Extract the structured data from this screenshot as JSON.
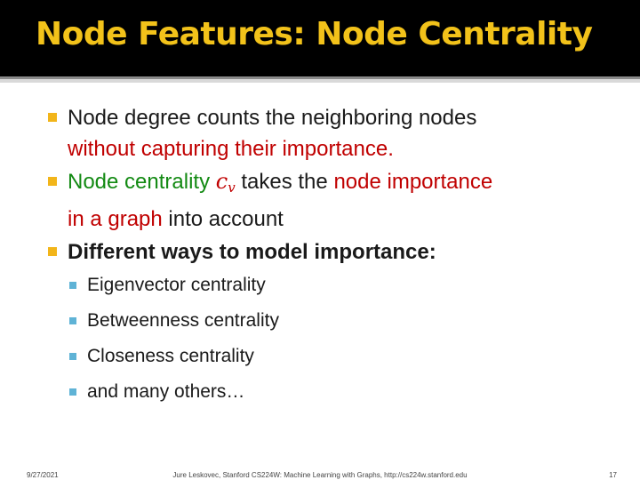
{
  "title": "Node Features: Node Centrality",
  "bullets": {
    "b1": {
      "text1": "Node degree counts the neighboring nodes",
      "text2": "without capturing their importance."
    },
    "b2": {
      "part1": "Node centrality",
      "math_base": "c",
      "math_sub": "v",
      "part2": "takes the",
      "part3": "node importance",
      "part4": "in a graph",
      "part5": "into account"
    },
    "b3": "Different ways to model importance:",
    "sub": [
      "Eigenvector centrality",
      "Betweenness centrality",
      "Closeness centrality",
      "and many others…"
    ]
  },
  "footer": {
    "date": "9/27/2021",
    "center": "Jure Leskovec, Stanford CS224W: Machine Learning with Graphs, http://cs224w.stanford.edu",
    "page": "17"
  },
  "colors": {
    "title": "#f2c21a",
    "title_bar": "#000000",
    "highlight_red": "#c00000",
    "highlight_green": "#138a13",
    "bullet_l1": "#f2b51a",
    "bullet_l2": "#5fb3d6"
  }
}
